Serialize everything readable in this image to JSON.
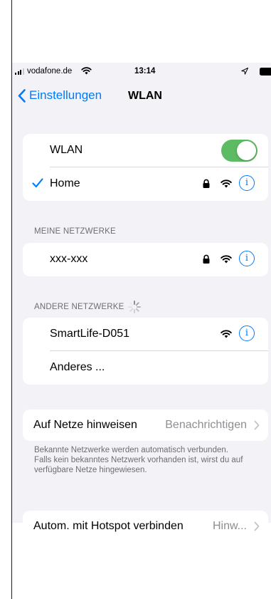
{
  "status_bar": {
    "carrier": "vodafone.de",
    "time": "13:14"
  },
  "nav": {
    "back_label": "Einstellungen",
    "title": "WLAN"
  },
  "wlan": {
    "toggle_label": "WLAN",
    "enabled": true,
    "connected_network": "Home"
  },
  "my_networks": {
    "header": "MEINE NETZWERKE",
    "items": [
      {
        "name": "xxx-xxx",
        "secured": true
      }
    ]
  },
  "other_networks": {
    "header": "ANDERE NETZWERKE",
    "items": [
      {
        "name": "SmartLife-D051",
        "secured": false
      }
    ],
    "other_label": "Anderes ..."
  },
  "ask_to_join": {
    "title": "Auf Netze hinweisen",
    "value": "Benachrichtigen",
    "footnote": "Bekannte Netzwerke werden automatisch verbunden. Falls kein bekanntes Netzwerk vorhanden ist, wirst du auf verfügbare Netze hingewiesen."
  },
  "hotspot": {
    "title": "Autom. mit Hotspot verbinden",
    "value": "Hinw..."
  },
  "colors": {
    "accent": "#007aff",
    "toggle_on": "#5dbb63",
    "grouped_background": "#f2f2f7",
    "secondary_text": "#6d6d72"
  }
}
